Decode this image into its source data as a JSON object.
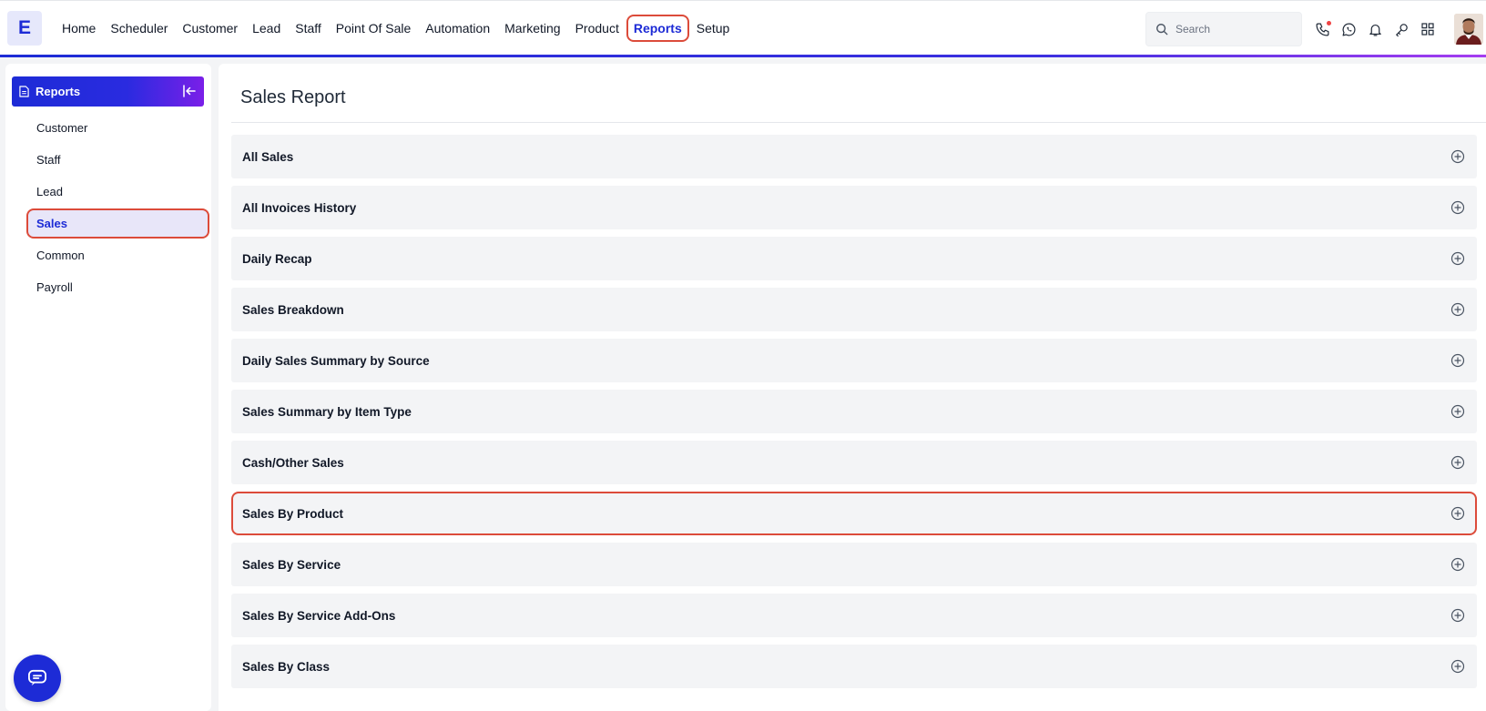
{
  "brand": {
    "logo_letter": "E"
  },
  "nav": {
    "items": [
      {
        "label": "Home"
      },
      {
        "label": "Scheduler"
      },
      {
        "label": "Customer"
      },
      {
        "label": "Lead"
      },
      {
        "label": "Staff"
      },
      {
        "label": "Point Of Sale"
      },
      {
        "label": "Automation"
      },
      {
        "label": "Marketing"
      },
      {
        "label": "Product"
      },
      {
        "label": "Reports"
      },
      {
        "label": "Setup"
      }
    ],
    "active": "Reports"
  },
  "search": {
    "placeholder": "Search"
  },
  "top_icons": [
    "phone-icon",
    "whatsapp-icon",
    "bell-icon",
    "key-icon",
    "grid-icon"
  ],
  "sidebar": {
    "header": "Reports",
    "items": [
      {
        "label": "Customer"
      },
      {
        "label": "Staff"
      },
      {
        "label": "Lead"
      },
      {
        "label": "Sales"
      },
      {
        "label": "Common"
      },
      {
        "label": "Payroll"
      }
    ],
    "active": "Sales"
  },
  "main": {
    "title": "Sales Report",
    "reports": [
      {
        "label": "All Sales"
      },
      {
        "label": "All Invoices History"
      },
      {
        "label": "Daily Recap"
      },
      {
        "label": "Sales Breakdown"
      },
      {
        "label": "Daily Sales Summary by Source"
      },
      {
        "label": "Sales Summary by Item Type"
      },
      {
        "label": "Cash/Other Sales"
      },
      {
        "label": "Sales By Product"
      },
      {
        "label": "Sales By Service"
      },
      {
        "label": "Sales By Service Add-Ons"
      },
      {
        "label": "Sales By Class"
      }
    ],
    "highlighted": "Sales By Product"
  },
  "colors": {
    "accent": "#1d2bd6",
    "highlight_border": "#dc4b3a",
    "row_bg": "#f3f4f6"
  }
}
